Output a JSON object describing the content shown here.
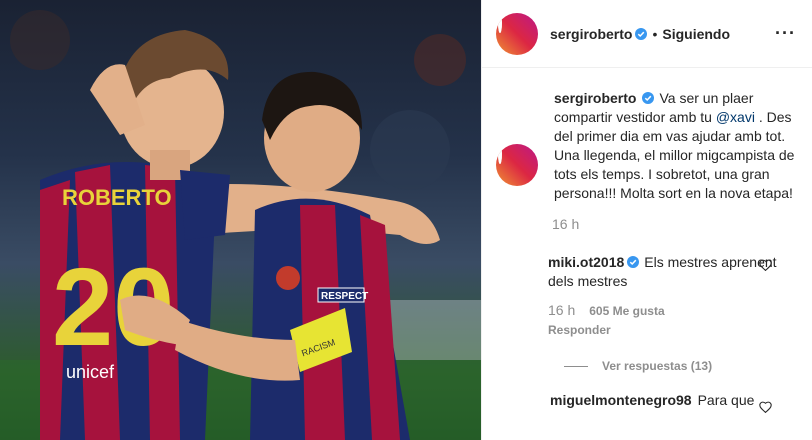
{
  "post": {
    "author": "sergiroberto",
    "follow_status": "Siguiendo",
    "dot": "•",
    "more_label": "···"
  },
  "caption": {
    "username": "sergiroberto",
    "text_before": "Va ser un plaer compartir vestidor amb tu ",
    "mention": "@xavi",
    "text_after": " . Des del primer dia em vas ajudar amb tot. Una llegenda, el millor migcampista de tots els temps. I sobretot, una gran persona!!! Molta sort en la nova etapa!",
    "time": "16 h"
  },
  "comments": [
    {
      "username": "miki.ot2018",
      "text": "Els mestres aprenent dels mestres",
      "time": "16 h",
      "likes": "605 Me gusta",
      "reply_label": "Responder",
      "view_replies": "Ver respuestas (13)"
    },
    {
      "username": "miguelmontenegro98",
      "text": "Para que"
    }
  ],
  "photo": {
    "jersey_name": "ROBERTO",
    "jersey_number": "20",
    "sponsor": "unicef",
    "sleeve_text": "RESPECT",
    "armband_text": "RACISM"
  },
  "colors": {
    "verified": "#3897f0",
    "link": "#00376b",
    "secondary": "#8e8e8e",
    "barca_blue": "#1c2b6b",
    "barca_red": "#a6123d",
    "gold": "#e8d33a"
  }
}
